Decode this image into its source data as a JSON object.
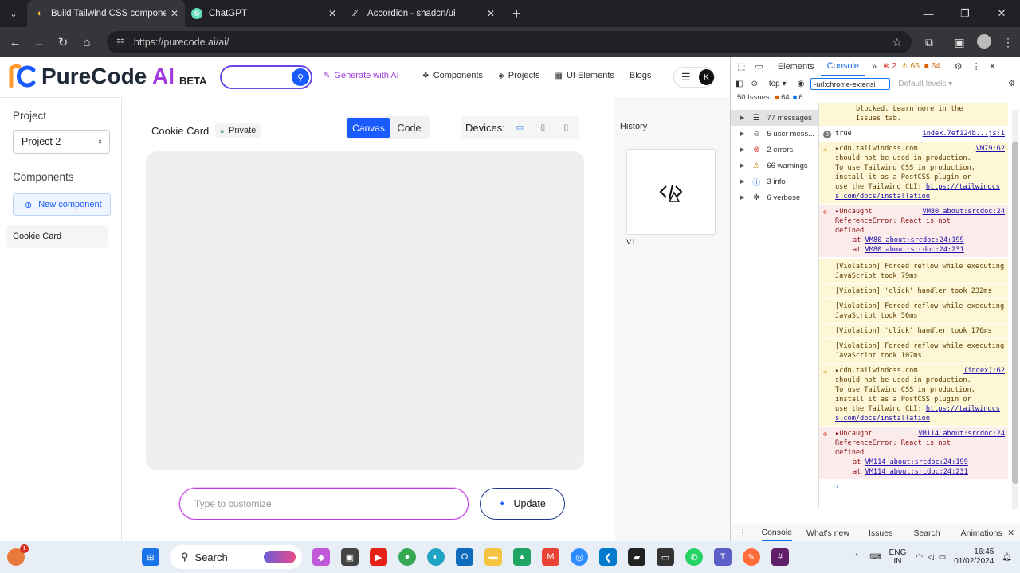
{
  "browser": {
    "tabs": [
      {
        "title": "Build Tailwind CSS components",
        "active": true
      },
      {
        "title": "ChatGPT",
        "active": false
      },
      {
        "title": "Accordion - shadcn/ui",
        "active": false
      }
    ],
    "url": "https://purecode.ai/ai/"
  },
  "nav": {
    "logo_main": "PureCode",
    "logo_ai": "AI",
    "beta": "BETA",
    "generate": "Generate with AI",
    "components": "Components",
    "projects": "Projects",
    "ui_elements": "UI Elements",
    "blogs": "Blogs",
    "avatar_initial": "K"
  },
  "sidebar": {
    "project_heading": "Project",
    "project_value": "Project 2",
    "components_heading": "Components",
    "new_component": "New component",
    "items": [
      "Cookie Card"
    ]
  },
  "main": {
    "title": "Cookie Card",
    "privacy": "Private",
    "tab_canvas": "Canvas",
    "tab_code": "Code",
    "devices_label": "Devices:",
    "customize_placeholder": "Type to customize",
    "update": "Update"
  },
  "history": {
    "heading": "History",
    "version": "V1"
  },
  "devtools": {
    "tabs": [
      "Elements",
      "Console"
    ],
    "err_count": "2",
    "warn_count": "66",
    "issue_count": "64",
    "context": "top",
    "filter": "-url:chrome-extensi",
    "levels": "Default levels",
    "issues_text": "50 Issues:",
    "issues_warn": "64",
    "issues_info": "6",
    "sidebar": [
      {
        "label": "77 messages",
        "icon": "list-icon"
      },
      {
        "label": "5 user mess...",
        "icon": "user-icon"
      },
      {
        "label": "2 errors",
        "icon": "error-icon"
      },
      {
        "label": "66 warnings",
        "icon": "warning-icon"
      },
      {
        "label": "3 info",
        "icon": "info-icon"
      },
      {
        "label": "6 verbose",
        "icon": "bug-icon"
      }
    ],
    "msgs": {
      "m0a": "blocked. Learn more in the",
      "m0b": "Issues tab.",
      "m1_text": "true",
      "m1_src": "index.7ef124b...js:1",
      "m1_count": "3",
      "w1_head": "cdn.tailwindcss.com",
      "w1_src": "VM79:62",
      "w1_l1": "should not be used in production.",
      "w1_l2": "To use Tailwind CSS in production,",
      "w1_l3": "install it as a PostCSS plugin or",
      "w1_l4": "use the Tailwind CLI:",
      "w1_link": "https://tailwindcss.com/docs/installation",
      "e1_head": "Uncaught",
      "e1_src": "VM80 about:srcdoc:24",
      "e1_l1": "ReferenceError: React is not",
      "e1_l2": "defined",
      "e1_at1": "VM80 about:srcdoc:24:199",
      "e1_at2": "VM80 about:srcdoc:24:231",
      "v1": "[Violation] Forced reflow while executing JavaScript took 79ms",
      "v2": "[Violation] 'click' handler took 232ms",
      "v3": "[Violation] Forced reflow while executing JavaScript took 56ms",
      "v4": "[Violation] 'click' handler took 176ms",
      "v5": "[Violation] Forced reflow while executing JavaScript took 107ms",
      "w2_head": "cdn.tailwindcss.com",
      "w2_src": "(index):62",
      "e2_head": "Uncaught",
      "e2_src": "VM114 about:srcdoc:24",
      "e2_at1": "VM114 about:srcdoc:24:199",
      "e2_at2": "VM114 about:srcdoc:24:231",
      "at": "at"
    },
    "drawer": [
      "Console",
      "What's new",
      "Issues",
      "Search",
      "Animations"
    ]
  },
  "taskbar": {
    "search": "Search",
    "lang1": "ENG",
    "lang2": "IN",
    "time": "16:45",
    "date": "01/02/2024",
    "badge": "1"
  },
  "colors": {
    "accent": "#1a5bff",
    "brand_purple": "#a23adf"
  }
}
